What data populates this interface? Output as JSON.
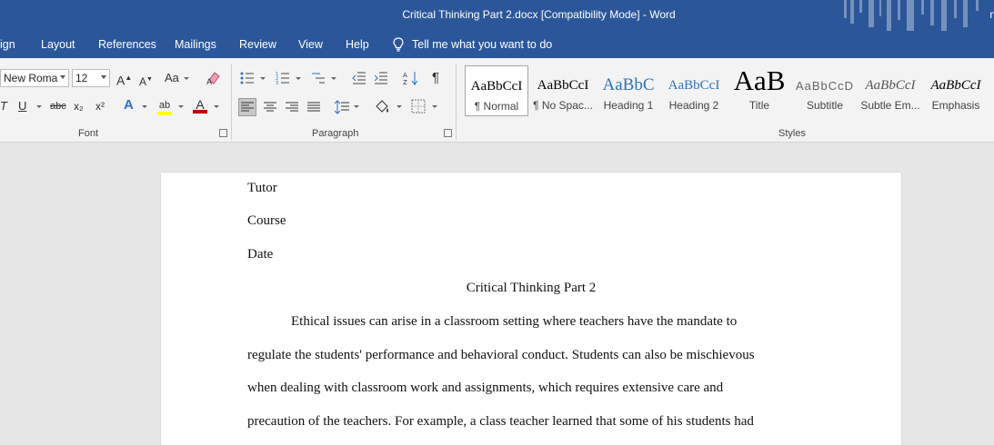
{
  "window": {
    "title": "Critical Thinking Part 2.docx [Compatibility Mode]  -  Word",
    "edge_letter": "n"
  },
  "tabs": [
    {
      "label": "ign"
    },
    {
      "label": "Layout"
    },
    {
      "label": "References"
    },
    {
      "label": "Mailings"
    },
    {
      "label": "Review"
    },
    {
      "label": "View"
    },
    {
      "label": "Help"
    }
  ],
  "tell_me": {
    "placeholder": "Tell me what you want to do"
  },
  "font_group": {
    "label": "Font",
    "font_name": "New Roma",
    "font_size": "12",
    "grow_glyph": "A",
    "shrink_glyph": "A",
    "case_glyph": "Aa",
    "underline_glyph": "U",
    "italic_glyph": "T",
    "strike_glyph": "abc",
    "subscript_glyph": "x₂",
    "superscript_glyph": "x²",
    "effects_glyph": "A",
    "highlight_glyph": "ab",
    "font_color_glyph": "A",
    "highlight_color": "#ffff00",
    "font_color": "#c00000"
  },
  "paragraph_group": {
    "label": "Paragraph",
    "pilcrow": "¶"
  },
  "styles_group": {
    "label": "Styles",
    "items": [
      {
        "preview": "AaBbCcI",
        "name": "¶ Normal"
      },
      {
        "preview": "AaBbCcI",
        "name": "¶ No Spac..."
      },
      {
        "preview": "AaBbC",
        "name": "Heading 1"
      },
      {
        "preview": "AaBbCcI",
        "name": "Heading 2"
      },
      {
        "preview": "AaB",
        "name": "Title"
      },
      {
        "preview": "AaBbCcD",
        "name": "Subtitle"
      },
      {
        "preview": "AaBbCcI",
        "name": "Subtle Em..."
      },
      {
        "preview": "AaBbCcI",
        "name": "Emphasis"
      }
    ]
  },
  "document": {
    "lines": [
      "Tutor",
      "Course",
      "Date"
    ],
    "heading": "Critical Thinking Part 2",
    "paragraph": [
      "Ethical issues can arise in a classroom setting where teachers have the mandate to",
      "regulate the students' performance and behavioral conduct. Students can also be mischievous",
      "when dealing with classroom work and assignments, which requires extensive care and",
      "precaution of the teachers. For example, a class teacher learned that some of his students had"
    ]
  },
  "colors": {
    "accent": "#2b579a",
    "ribbon": "#f3f3f3",
    "canvas": "#e6e6e6"
  }
}
